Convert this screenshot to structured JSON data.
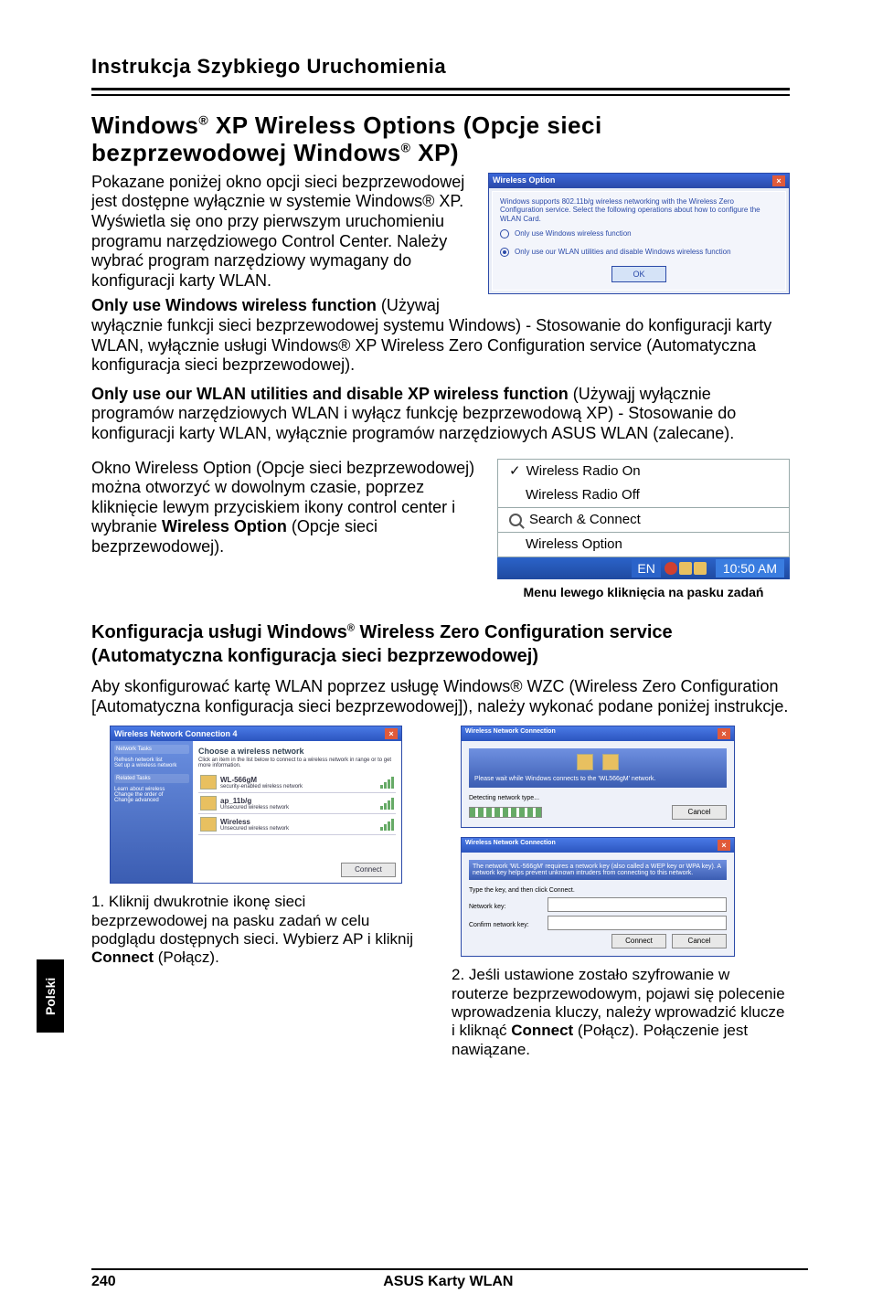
{
  "top_header": "Instrukcja Szybkiego Uruchomienia",
  "section_title_pre": "Windows",
  "section_title_mid": " XP Wireless Options (Opcje sieci bezprzewodowej Windows",
  "section_title_end": " XP)",
  "p1": "Pokazane poniżej okno opcji sieci bezprzewodowej jest dostępne wyłącznie w systemie Windows® XP. Wyświetla się ono przy pierwszym uruchomieniu programu narzędziowego Control Center. Należy wybrać program narzędziowy wymagany do konfiguracji karty WLAN.",
  "wireless_option_dialog": {
    "title": "Wireless Option",
    "info": "Windows supports 802.11b/g wireless networking with the Wireless Zero Configuration service. Select the following operations about how to configure the WLAN Card.",
    "radio1": "Only use Windows wireless function",
    "radio2": "Only use our WLAN utilities and disable Windows wireless function",
    "ok": "OK"
  },
  "only_windows_heading": "Only use Windows wireless function",
  "only_windows_body": " (Używaj wyłącznie funkcji sieci bezprzewodowej systemu Windows) - Stosowanie do konfiguracji karty WLAN, wyłącznie usługi Windows® XP Wireless Zero Configuration service (Automatyczna konfiguracja sieci bezprzewodowej).",
  "only_wlan_heading": "Only use our WLAN utilities and disable XP wireless function",
  "only_wlan_body": " (Używajj wyłącznie programów narzędziowych WLAN i wyłącz funkcję bezprzewodową XP) - Stosowanie do konfiguracji karty WLAN, wyłącznie programów narzędziowych ASUS WLAN (zalecane).",
  "open_option_text": "Okno Wireless Option (Opcje sieci bezprzewodowej) można otworzyć w dowolnym czasie, poprzez kliknięcie lewym przyciskiem ikony control center i wybranie ",
  "open_option_bold": "Wireless Option",
  "open_option_after": " (Opcje sieci bezprzewodowej).",
  "taskbar_menu": {
    "radio_on": "Wireless Radio On",
    "radio_off": "Wireless Radio Off",
    "search": "Search & Connect",
    "option": "Wireless Option",
    "lang": "EN",
    "time": "10:50 AM"
  },
  "taskbar_caption": "Menu lewego kliknięcia na pasku zadań",
  "subsection_pre": "Konfiguracja usługi Windows",
  "subsection_mid": " Wireless Zero Configuration service (Automatyczna konfiguracja sieci bezprzewodowej)",
  "wzc_intro": "Aby skonfigurować kartę WLAN poprzez usługę Windows® WZC (Wireless Zero Configuration [Automatyczna konfiguracja sieci bezprzewodowej]), należy wykonać podane poniżej instrukcje.",
  "net_dialog": {
    "title": "Wireless Network Connection 4",
    "choose": "Choose a wireless network",
    "desc": "Click an item in the list below to connect to a wireless network in range or to get more information.",
    "panel_items": [
      "Network Tasks",
      "Refresh network list",
      "Set up a wireless network",
      "Related Tasks",
      "Learn about wireless",
      "Change the order of",
      "Change advanced"
    ],
    "nets": [
      "WL-566gM",
      "security-enabled wireless network",
      "ap_11b/g",
      "Unsecured wireless network",
      "Wireless",
      "Unsecured wireless network"
    ],
    "connect": "Connect"
  },
  "connect_dialog": {
    "title": "Wireless Network Connection",
    "banner_text": "Please wait while Windows connects to the 'WL566gM' network.",
    "field": "••••",
    "cancel": "Cancel"
  },
  "key_dialog": {
    "title": "Wireless Network Connection",
    "info": "The network 'WL-566gM' requires a network key (also called a WEP key or WPA key). A network key helps prevent unknown intruders from connecting to this network.",
    "label1": "Type the key, and then click Connect.",
    "label2": "Network key:",
    "label3": "Confirm network key:",
    "connect": "Connect",
    "cancel": "Cancel"
  },
  "step1": "1. Kliknij dwukrotnie ikonę sieci bezprzewodowej na pasku zadań w celu podglądu dostępnych sieci. Wybierz AP i kliknij ",
  "step1_bold": "Connect",
  "step1_after": " (Połącz).",
  "step2": "2. Jeśli ustawione zostało szyfrowanie w routerze bezprzewodowym, pojawi się polecenie wprowadzenia kluczy, należy wprowadzić klucze i kliknąć ",
  "step2_bold": "Connect",
  "step2_after": " (Połącz). Połączenie jest nawiązane.",
  "side_tab": "Polski",
  "footer_page": "240",
  "footer_center": "ASUS Karty WLAN"
}
